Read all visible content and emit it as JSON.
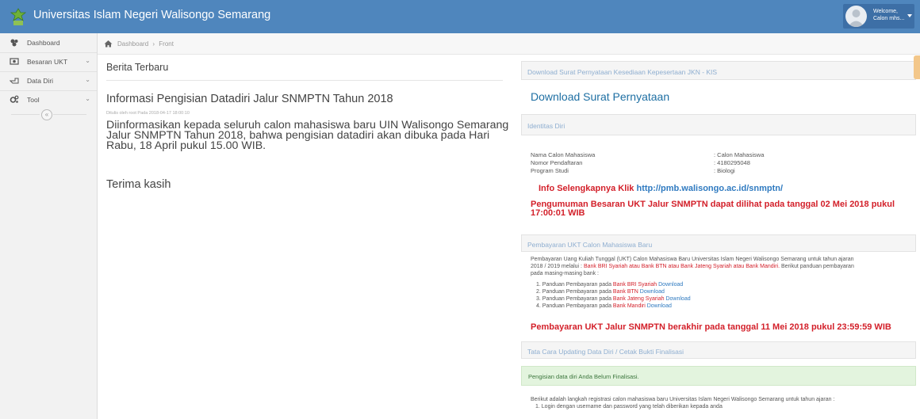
{
  "app": {
    "title": "Universitas Islam Negeri Walisongo Semarang",
    "welcome": "Welcome,",
    "user_name": "Calon mhs..."
  },
  "sidebar": {
    "items": [
      {
        "label": "Dashboard",
        "icon": "dashboard-icon"
      },
      {
        "label": "Besaran UKT",
        "icon": "money-icon"
      },
      {
        "label": "Data Diri",
        "icon": "hand-pointer-icon"
      },
      {
        "label": "Tool",
        "icon": "cogs-icon"
      }
    ],
    "collapse_glyph": "«"
  },
  "breadcrumb": {
    "home": "Dashboard",
    "sep": "›",
    "current": "Front"
  },
  "news": {
    "section_title": "Berita Terbaru",
    "post_title": "Informasi Pengisian Datadiri Jalur SNMPTN Tahun 2018",
    "post_meta": "Ditulis oleh root Pada 2018-04-17 18:00:10",
    "post_body": "Diinformasikan kepada seluruh calon mahasiswa baru UIN Walisongo Semarang Jalur SNMPTN Tahun 2018, bahwa pengisian datadiri akan dibuka pada Hari Rabu, 18 April pukul 15.00 WIB.",
    "post_thanks": "Terima kasih"
  },
  "right": {
    "panel_download_title": "Download Surat Pernyataan Kesediaan Kepesertaan JKN - KIS",
    "download_link": "Download Surat Pernyataan",
    "panel_identity_title": "Identitas Diri",
    "identity": [
      {
        "label": "Nama Calon Mahasiswa",
        "value": ": Calon Mahasiswa"
      },
      {
        "label": "Nomor Pendaftaran",
        "value": ": 4180295048"
      },
      {
        "label": "Program Studi",
        "value": ": Biologi"
      }
    ],
    "info_prefix": "Info Selengkapnya Klik",
    "info_url": "http://pmb.walisongo.ac.id/snmptn/",
    "announcement": "Pengumuman Besaran UKT Jalur SNMPTN dapat dilihat pada tanggal 02 Mei 2018 pukul 17:00:01 WIB",
    "panel_payment_title": "Pembayaran UKT Calon Mahasiswa Baru",
    "payment_intro_1": "Pembayaran Uang Kuliah Tunggal (UKT) Calon Mahasiswa Baru Universitas Islam Negeri Walisongo Semarang untuk tahun ajaran",
    "payment_intro_2a": "2018 / 2019 melalui :",
    "payment_intro_2b": "Bank BRI Syariah atau Bank BTN atau Bank Jateng Syariah atau Bank Mandiri.",
    "payment_intro_2c": "Berikut panduan pembayaran",
    "payment_intro_3": "pada masing-masing bank :",
    "guides": [
      {
        "prefix": "1. Panduan Pembayaran pada",
        "bank": "Bank BRI Syariah",
        "link": "Download"
      },
      {
        "prefix": "2. Panduan Pembayaran pada",
        "bank": "Bank BTN",
        "link": "Download"
      },
      {
        "prefix": "3. Panduan Pembayaran pada",
        "bank": "Bank Jateng Syariah",
        "link": "Download"
      },
      {
        "prefix": "4. Panduan Pembayaran pada",
        "bank": "Bank Mandiri",
        "link": "Download"
      }
    ],
    "payment_deadline": "Pembayaran UKT Jalur SNMPTN berakhir pada tanggal 11 Mei 2018 pukul 23:59:59 WIB",
    "panel_update_title": "Tata Cara Updating Data Diri / Cetak Bukti Finalisasi",
    "alert": "Pengisian data diri Anda Belum Finalisasi.",
    "steps_intro": "Berikut adalah langkah registrasi calon mahasiswa baru Universitas Islam Negeri Walisongo Semarang untuk tahun ajaran :",
    "step_1": "1. Login dengan username dan password yang telah diberikan kepada anda"
  },
  "colors": {
    "topbar": "#4f86bd",
    "accent_red": "#d3202a",
    "link_blue": "#1e6fa3"
  }
}
